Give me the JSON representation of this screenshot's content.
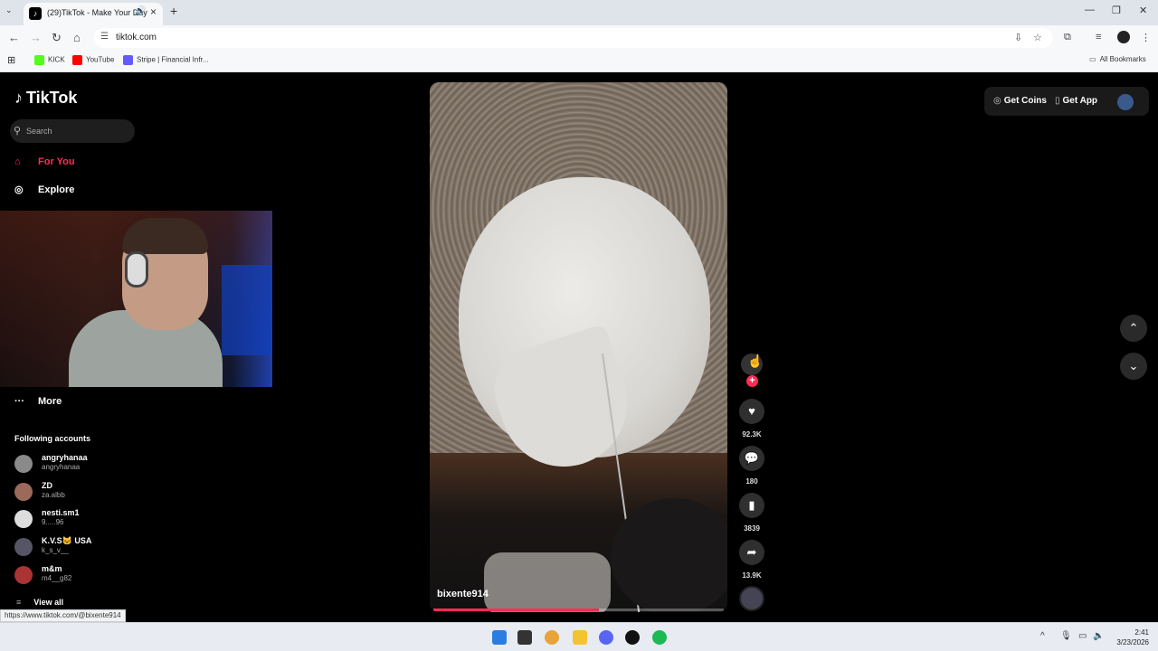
{
  "browser": {
    "tab_title": "(29)TikTok - Make Your Day",
    "url": "tiktok.com",
    "bookmarks": [
      "KICK",
      "YouTube",
      "Stripe | Financial Infr..."
    ],
    "all_bookmarks": "All Bookmarks",
    "status_url": "https://www.tiktok.com/@bixente914"
  },
  "sidebar": {
    "logo": "TikTok",
    "search_placeholder": "Search",
    "nav": {
      "for_you": "For You",
      "explore": "Explore",
      "more": "More"
    },
    "following_title": "Following accounts",
    "accounts": [
      {
        "name": "angryhanaa",
        "username": "angryhanaa"
      },
      {
        "name": "ZD",
        "username": "za.albb"
      },
      {
        "name": "nesti.sm1",
        "username": "9.....96"
      },
      {
        "name": "K.V.S🐱 USA",
        "username": "k_s_v__"
      },
      {
        "name": "m&m",
        "username": "m4__g82"
      }
    ],
    "view_all": "View all"
  },
  "video": {
    "author": "bixente914",
    "progress": 0.57
  },
  "actions": {
    "likes": "92.3K",
    "comments": "180",
    "saves": "3839",
    "shares": "13.9K"
  },
  "header_right": {
    "get_coins": "Get Coins",
    "get_app": "Get App"
  },
  "taskbar": {
    "time": "2:41",
    "date": "3/23/2026"
  },
  "colors": {
    "accent": "#fe2c55",
    "background": "#000000"
  }
}
